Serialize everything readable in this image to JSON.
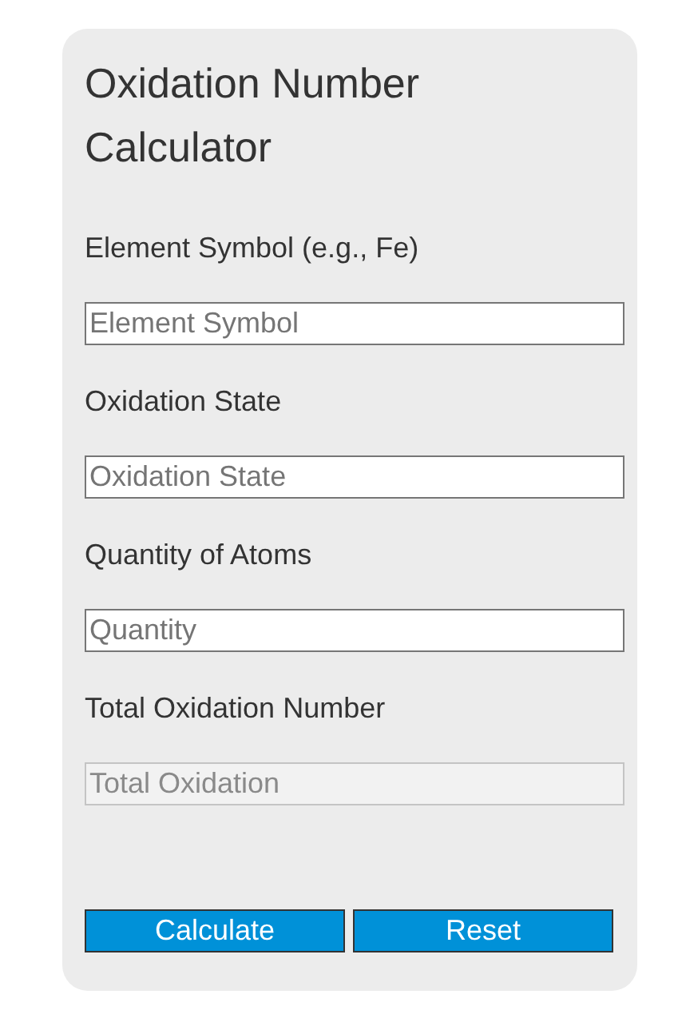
{
  "title": "Oxidation Number Calculator",
  "fields": [
    {
      "label": "Element Symbol (e.g., Fe)",
      "placeholder": "Element Symbol",
      "disabled": false
    },
    {
      "label": "Oxidation State",
      "placeholder": "Oxidation State",
      "disabled": false
    },
    {
      "label": "Quantity of Atoms",
      "placeholder": "Quantity",
      "disabled": false
    },
    {
      "label": "Total Oxidation Number",
      "placeholder": "Total Oxidation",
      "disabled": true
    }
  ],
  "buttons": [
    "Calculate",
    "Reset"
  ]
}
